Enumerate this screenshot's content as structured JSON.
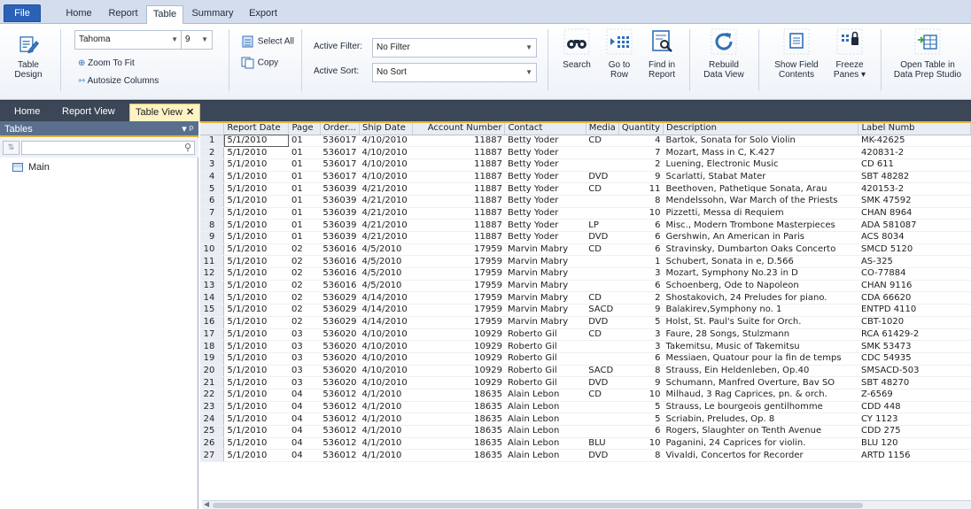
{
  "ribbon_tabs": [
    "File",
    "Home",
    "Report",
    "Table",
    "Summary",
    "Export"
  ],
  "ribbon": {
    "table_design": "Table\nDesign",
    "font_name": "Tahoma",
    "font_size": "9",
    "zoom_to_fit": "Zoom To Fit",
    "autosize_columns": "Autosize Columns",
    "select_all": "Select All",
    "copy": "Copy",
    "active_filter_label": "Active Filter:",
    "active_filter_value": "No Filter",
    "active_sort_label": "Active Sort:",
    "active_sort_value": "No Sort",
    "search": "Search",
    "go_to_row": "Go to\nRow",
    "find_in_report": "Find in\nReport",
    "rebuild_data_view": "Rebuild\nData View",
    "show_field_contents": "Show Field\nContents",
    "freeze_panes": "Freeze\nPanes ▾",
    "open_table": "Open Table in\nData Prep Studio"
  },
  "doc_tabs": [
    "Home",
    "Report View",
    "Table View"
  ],
  "left_panel": {
    "title": "Tables",
    "pin": "▾ ᵖ",
    "items": [
      "Main"
    ]
  },
  "colors": {
    "accent": "#e6b43c",
    "file_tab": "#2b62b8",
    "doc_bar": "#3b4656"
  },
  "grid": {
    "columns": [
      "Report Date",
      "Page",
      "Order...",
      "Ship Date",
      "Account Number",
      "Contact",
      "Media",
      "Quantity",
      "Description",
      "Label Numb"
    ],
    "rows": [
      [
        "1",
        "5/1/2010",
        "01",
        "536017",
        "4/10/2010",
        "11887",
        "Betty Yoder",
        "CD",
        "4",
        "Bartok, Sonata for Solo Violin",
        "MK-42625"
      ],
      [
        "2",
        "5/1/2010",
        "01",
        "536017",
        "4/10/2010",
        "11887",
        "Betty Yoder",
        "",
        "7",
        "Mozart, Mass in C, K.427",
        "420831-2"
      ],
      [
        "3",
        "5/1/2010",
        "01",
        "536017",
        "4/10/2010",
        "11887",
        "Betty Yoder",
        "",
        "2",
        "Luening, Electronic Music",
        "CD 611"
      ],
      [
        "4",
        "5/1/2010",
        "01",
        "536017",
        "4/10/2010",
        "11887",
        "Betty Yoder",
        "DVD",
        "9",
        "Scarlatti, Stabat Mater",
        "SBT 48282"
      ],
      [
        "5",
        "5/1/2010",
        "01",
        "536039",
        "4/21/2010",
        "11887",
        "Betty Yoder",
        "CD",
        "11",
        "Beethoven, Pathetique Sonata, Arau",
        "420153-2"
      ],
      [
        "6",
        "5/1/2010",
        "01",
        "536039",
        "4/21/2010",
        "11887",
        "Betty Yoder",
        "",
        "8",
        "Mendelssohn, War March of the Priests",
        "SMK 47592"
      ],
      [
        "7",
        "5/1/2010",
        "01",
        "536039",
        "4/21/2010",
        "11887",
        "Betty Yoder",
        "",
        "10",
        "Pizzetti, Messa di Requiem",
        "CHAN 8964"
      ],
      [
        "8",
        "5/1/2010",
        "01",
        "536039",
        "4/21/2010",
        "11887",
        "Betty Yoder",
        "LP",
        "6",
        "Misc., Modern Trombone Masterpieces",
        "ADA 581087"
      ],
      [
        "9",
        "5/1/2010",
        "01",
        "536039",
        "4/21/2010",
        "11887",
        "Betty Yoder",
        "DVD",
        "6",
        "Gershwin, An American in Paris",
        "ACS 8034"
      ],
      [
        "10",
        "5/1/2010",
        "02",
        "536016",
        "4/5/2010",
        "17959",
        "Marvin Mabry",
        "CD",
        "6",
        "Stravinsky, Dumbarton Oaks Concerto",
        "SMCD 5120"
      ],
      [
        "11",
        "5/1/2010",
        "02",
        "536016",
        "4/5/2010",
        "17959",
        "Marvin Mabry",
        "",
        "1",
        "Schubert, Sonata in e, D.566",
        "AS-325"
      ],
      [
        "12",
        "5/1/2010",
        "02",
        "536016",
        "4/5/2010",
        "17959",
        "Marvin Mabry",
        "",
        "3",
        "Mozart, Symphony No.23 in D",
        "CO-77884"
      ],
      [
        "13",
        "5/1/2010",
        "02",
        "536016",
        "4/5/2010",
        "17959",
        "Marvin Mabry",
        "",
        "6",
        "Schoenberg, Ode to Napoleon",
        "CHAN 9116"
      ],
      [
        "14",
        "5/1/2010",
        "02",
        "536029",
        "4/14/2010",
        "17959",
        "Marvin Mabry",
        "CD",
        "2",
        "Shostakovich, 24 Preludes for piano.",
        "CDA 66620"
      ],
      [
        "15",
        "5/1/2010",
        "02",
        "536029",
        "4/14/2010",
        "17959",
        "Marvin Mabry",
        "SACD",
        "9",
        "Balakirev,Symphony no. 1",
        "ENTPD 4110"
      ],
      [
        "16",
        "5/1/2010",
        "02",
        "536029",
        "4/14/2010",
        "17959",
        "Marvin Mabry",
        "DVD",
        "5",
        "Holst, St. Paul's Suite for Orch.",
        "CBT-1020"
      ],
      [
        "17",
        "5/1/2010",
        "03",
        "536020",
        "4/10/2010",
        "10929",
        "Roberto Gil",
        "CD",
        "3",
        "Faure, 28 Songs, Stulzmann",
        "RCA 61429-2"
      ],
      [
        "18",
        "5/1/2010",
        "03",
        "536020",
        "4/10/2010",
        "10929",
        "Roberto Gil",
        "",
        "3",
        "Takemitsu, Music of Takemitsu",
        "SMK 53473"
      ],
      [
        "19",
        "5/1/2010",
        "03",
        "536020",
        "4/10/2010",
        "10929",
        "Roberto Gil",
        "",
        "6",
        "Messiaen, Quatour pour la fin de temps",
        "CDC 54935"
      ],
      [
        "20",
        "5/1/2010",
        "03",
        "536020",
        "4/10/2010",
        "10929",
        "Roberto Gil",
        "SACD",
        "8",
        "Strauss, Ein Heldenleben, Op.40",
        "SMSACD-503"
      ],
      [
        "21",
        "5/1/2010",
        "03",
        "536020",
        "4/10/2010",
        "10929",
        "Roberto Gil",
        "DVD",
        "9",
        "Schumann, Manfred Overture, Bav SO",
        "SBT 48270"
      ],
      [
        "22",
        "5/1/2010",
        "04",
        "536012",
        "4/1/2010",
        "18635",
        "Alain Lebon",
        "CD",
        "10",
        "Milhaud, 3 Rag Caprices, pn. & orch.",
        "Z-6569"
      ],
      [
        "23",
        "5/1/2010",
        "04",
        "536012",
        "4/1/2010",
        "18635",
        "Alain Lebon",
        "",
        "5",
        "Strauss, Le bourgeois gentilhomme",
        "CDD 448"
      ],
      [
        "24",
        "5/1/2010",
        "04",
        "536012",
        "4/1/2010",
        "18635",
        "Alain Lebon",
        "",
        "5",
        "Scriabin, Preludes, Op. 8",
        "CY 1123"
      ],
      [
        "25",
        "5/1/2010",
        "04",
        "536012",
        "4/1/2010",
        "18635",
        "Alain Lebon",
        "",
        "6",
        "Rogers, Slaughter on Tenth Avenue",
        "CDD 275"
      ],
      [
        "26",
        "5/1/2010",
        "04",
        "536012",
        "4/1/2010",
        "18635",
        "Alain Lebon",
        "BLU",
        "10",
        "Paganini, 24 Caprices for violin.",
        "BLU 120"
      ],
      [
        "27",
        "5/1/2010",
        "04",
        "536012",
        "4/1/2010",
        "18635",
        "Alain Lebon",
        "DVD",
        "8",
        "Vivaldi, Concertos for Recorder",
        "ARTD 1156"
      ]
    ]
  }
}
